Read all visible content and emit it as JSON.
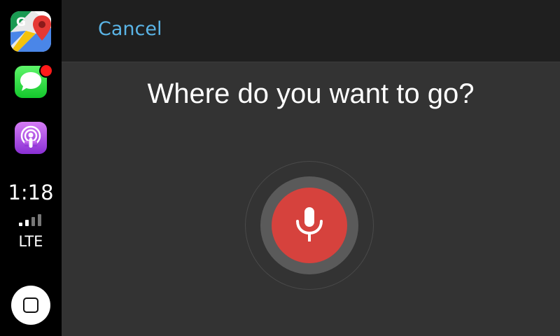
{
  "sidebar": {
    "apps": [
      {
        "name": "maps",
        "icon": "google-maps-icon"
      },
      {
        "name": "messages",
        "icon": "messages-icon",
        "badge": true
      },
      {
        "name": "podcasts",
        "icon": "podcasts-icon"
      }
    ],
    "time": "1:18",
    "signal_bars": 2,
    "signal_total": 4,
    "network": "LTE",
    "home_icon": "home-square-icon"
  },
  "topbar": {
    "cancel_label": "Cancel"
  },
  "main": {
    "prompt": "Where do you want to go?",
    "mic_icon": "microphone-icon"
  },
  "colors": {
    "accent": "#5ab4e6",
    "mic_red": "#d6423d",
    "badge_red": "#ff1a1a",
    "background": "#333333",
    "topbar": "#1f1f1f"
  }
}
